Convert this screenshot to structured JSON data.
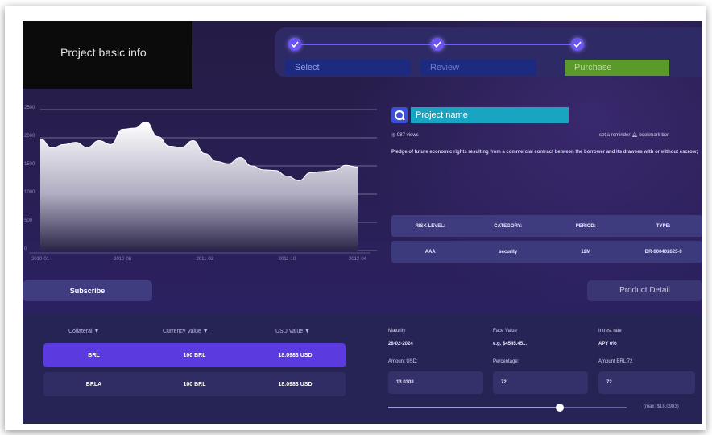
{
  "header": {
    "basic_info": "Project basic info"
  },
  "stepper": {
    "steps": [
      {
        "label": "Select",
        "bg": "#1c2a80"
      },
      {
        "label": "Review",
        "bg": "#1c2a80"
      },
      {
        "label": "Purchase",
        "bg": "#5a9a2a"
      }
    ],
    "accent": "#6b57f0"
  },
  "chart_data": {
    "type": "area",
    "x": [
      "2010-01",
      "2010-02",
      "2010-03",
      "2010-04",
      "2010-05",
      "2010-06",
      "2010-07",
      "2010-08",
      "2010-09",
      "2010-10",
      "2010-11",
      "2010-12",
      "2011-01",
      "2011-02",
      "2011-03",
      "2011-04",
      "2011-05",
      "2011-06",
      "2011-07",
      "2011-08",
      "2011-09",
      "2011-10",
      "2011-11",
      "2011-12",
      "2012-01",
      "2012-02",
      "2012-03",
      "2012-04"
    ],
    "values": [
      1980,
      1820,
      1880,
      1920,
      1830,
      1950,
      1880,
      2150,
      2170,
      2280,
      2020,
      1850,
      1830,
      1950,
      1720,
      1580,
      1540,
      1650,
      1500,
      1430,
      1420,
      1320,
      1240,
      1380,
      1400,
      1420,
      1510,
      1480
    ],
    "xticks": [
      "2010-01",
      "2010-08",
      "2011-03",
      "2011-10",
      "2012-04"
    ],
    "yticks": [
      "0",
      "500",
      "1000",
      "1500",
      "2000",
      "2500"
    ],
    "ylim": [
      0,
      2500
    ],
    "grid": true
  },
  "project": {
    "name": "Project name",
    "views": "987 views",
    "reminder": "set a reminder",
    "bookmark": "bookmark bon",
    "description": "Pledge of future economic rights resulting from a commercial contract between the borrower and its drawees with or without escrow;"
  },
  "info_table": {
    "headers": [
      "RISK LEVEL:",
      "CATEGORY:",
      "PERIOD:",
      "TYPE:"
    ],
    "values": [
      "AAA",
      "security",
      "12M",
      "BR-000402625-0"
    ]
  },
  "buttons": {
    "subscribe": "Subscribe",
    "product_detail": "Product Detail"
  },
  "collateral": {
    "headers": [
      "Collateral ▼",
      "Currency Value ▼",
      "USD Value ▼"
    ],
    "rows": [
      {
        "name": "BRL",
        "currency": "100 BRL",
        "usd": "18.0983 USD"
      },
      {
        "name": "BRLA",
        "currency": "100 BRL",
        "usd": "18.0983 USD"
      }
    ]
  },
  "details": {
    "maturity_label": "Maturity",
    "maturity_value": "28-02-2024",
    "face_label": "Face Value",
    "face_value": "e.g. $4545.45...",
    "rate_label": "Intrest rate",
    "rate_value": "APY 6%",
    "amount_usd_label": "Amount USD:",
    "amount_usd_value": "13.0308",
    "percentage_label": "Percentage:",
    "percentage_value": "72",
    "amount_brl_label": "Amount BRL:72",
    "amount_brl_value": "72",
    "max_label": "(max: $18.0983)",
    "slider_level": 0.72
  }
}
